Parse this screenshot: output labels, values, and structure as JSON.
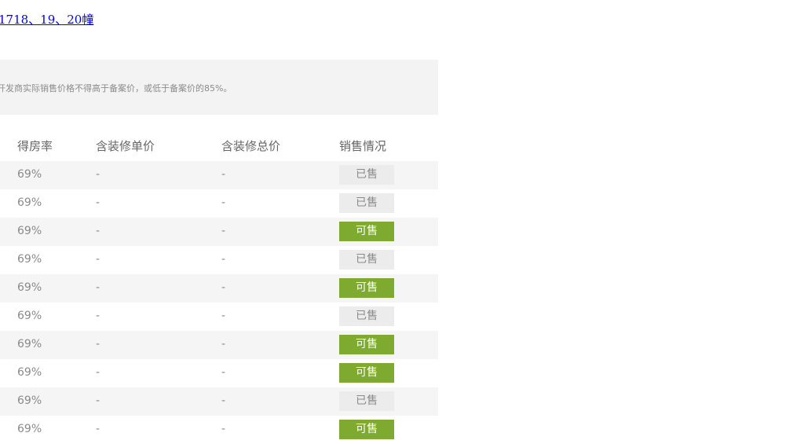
{
  "building_link": "1718、19、20幢",
  "notice": "开发商实际销售价格不得高于备案价，或低于备案价的85%。",
  "table": {
    "headers": [
      "得房率",
      "含装修单价",
      "含装修总价",
      "销售情况"
    ],
    "rows": [
      {
        "rate": "69%",
        "unit_price": "-",
        "total_price": "-",
        "status": "已售",
        "status_key": "sold"
      },
      {
        "rate": "69%",
        "unit_price": "-",
        "total_price": "-",
        "status": "已售",
        "status_key": "sold"
      },
      {
        "rate": "69%",
        "unit_price": "-",
        "total_price": "-",
        "status": "可售",
        "status_key": "available"
      },
      {
        "rate": "69%",
        "unit_price": "-",
        "total_price": "-",
        "status": "已售",
        "status_key": "sold"
      },
      {
        "rate": "69%",
        "unit_price": "-",
        "total_price": "-",
        "status": "可售",
        "status_key": "available"
      },
      {
        "rate": "69%",
        "unit_price": "-",
        "total_price": "-",
        "status": "已售",
        "status_key": "sold"
      },
      {
        "rate": "69%",
        "unit_price": "-",
        "total_price": "-",
        "status": "可售",
        "status_key": "available"
      },
      {
        "rate": "69%",
        "unit_price": "-",
        "total_price": "-",
        "status": "可售",
        "status_key": "available"
      },
      {
        "rate": "69%",
        "unit_price": "-",
        "total_price": "-",
        "status": "已售",
        "status_key": "sold"
      },
      {
        "rate": "69%",
        "unit_price": "-",
        "total_price": "-",
        "status": "可售",
        "status_key": "available"
      }
    ]
  },
  "colors": {
    "available_badge": "#7eaa2f",
    "sold_badge": "#ececec",
    "notice_background": "#f3f3f3"
  }
}
